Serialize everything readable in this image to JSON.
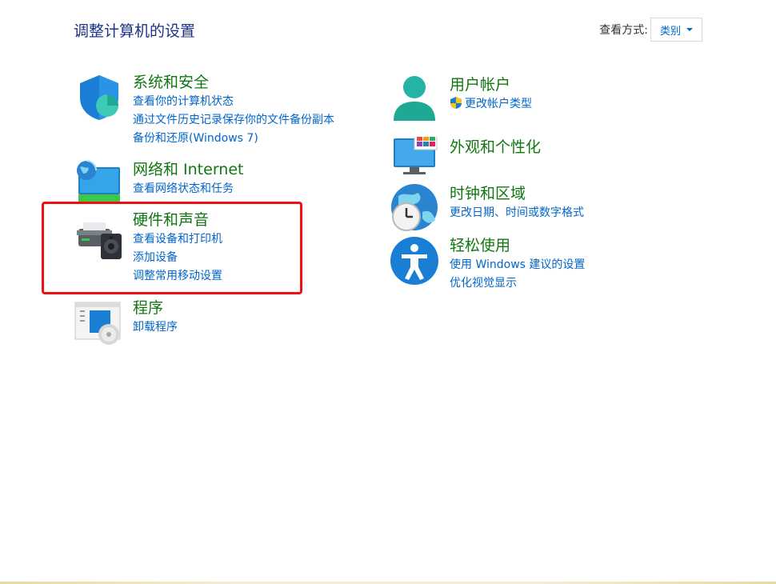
{
  "header": {
    "title": "调整计算机的设置",
    "view_by_label": "查看方式:",
    "view_by_value": "类别"
  },
  "categories": {
    "system_security": {
      "title": "系统和安全",
      "icon": "shield-icon",
      "links": [
        "查看你的计算机状态",
        "通过文件历史记录保存你的文件备份副本",
        "备份和还原(Windows 7)"
      ]
    },
    "network": {
      "title": "网络和 Internet",
      "icon": "network-globe-icon",
      "links": [
        "查看网络状态和任务"
      ]
    },
    "hardware_sound": {
      "title": "硬件和声音",
      "icon": "printer-speaker-icon",
      "links": [
        "查看设备和打印机",
        "添加设备",
        "调整常用移动设置"
      ]
    },
    "programs": {
      "title": "程序",
      "icon": "programs-disc-icon",
      "links": [
        "卸载程序"
      ]
    },
    "user_accounts": {
      "title": "用户帐户",
      "icon": "user-icon",
      "links": [
        "更改帐户类型"
      ]
    },
    "appearance": {
      "title": "外观和个性化",
      "icon": "monitor-palette-icon",
      "links": []
    },
    "clock_region": {
      "title": "时钟和区域",
      "icon": "clock-globe-icon",
      "links": [
        "更改日期、时间或数字格式"
      ]
    },
    "ease_of_access": {
      "title": "轻松使用",
      "icon": "accessibility-icon",
      "links": [
        "使用 Windows 建议的设置",
        "优化视觉显示"
      ]
    }
  },
  "colors": {
    "title_blue": "#1e3287",
    "category_green": "#117711",
    "link_blue": "#0066cc",
    "highlight_red": "#ee1111"
  }
}
